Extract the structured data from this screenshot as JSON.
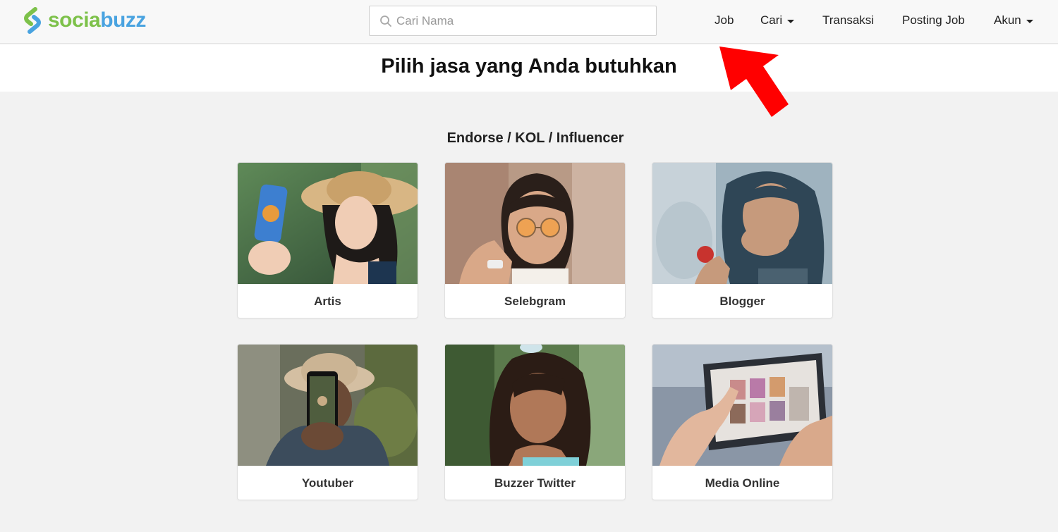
{
  "brand": {
    "name_part1": "socia",
    "name_part2": "buzz",
    "color_green": "#7dc14a",
    "color_blue": "#49a3e0"
  },
  "search": {
    "placeholder": "Cari Nama",
    "value": ""
  },
  "nav": {
    "items": [
      {
        "label": "Job",
        "has_dropdown": false
      },
      {
        "label": "Cari",
        "has_dropdown": true
      },
      {
        "label": "Transaksi",
        "has_dropdown": false
      },
      {
        "label": "Posting Job",
        "has_dropdown": false
      },
      {
        "label": "Akun",
        "has_dropdown": true
      }
    ]
  },
  "hero": {
    "title": "Pilih jasa yang Anda butuhkan"
  },
  "section": {
    "title": "Endorse / KOL / Influencer",
    "cards": [
      {
        "label": "Artis"
      },
      {
        "label": "Selebgram"
      },
      {
        "label": "Blogger"
      },
      {
        "label": "Youtuber"
      },
      {
        "label": "Buzzer Twitter"
      },
      {
        "label": "Media Online"
      }
    ]
  },
  "annotation": {
    "color": "#ff0000",
    "icon": "red-arrow-pointer"
  }
}
